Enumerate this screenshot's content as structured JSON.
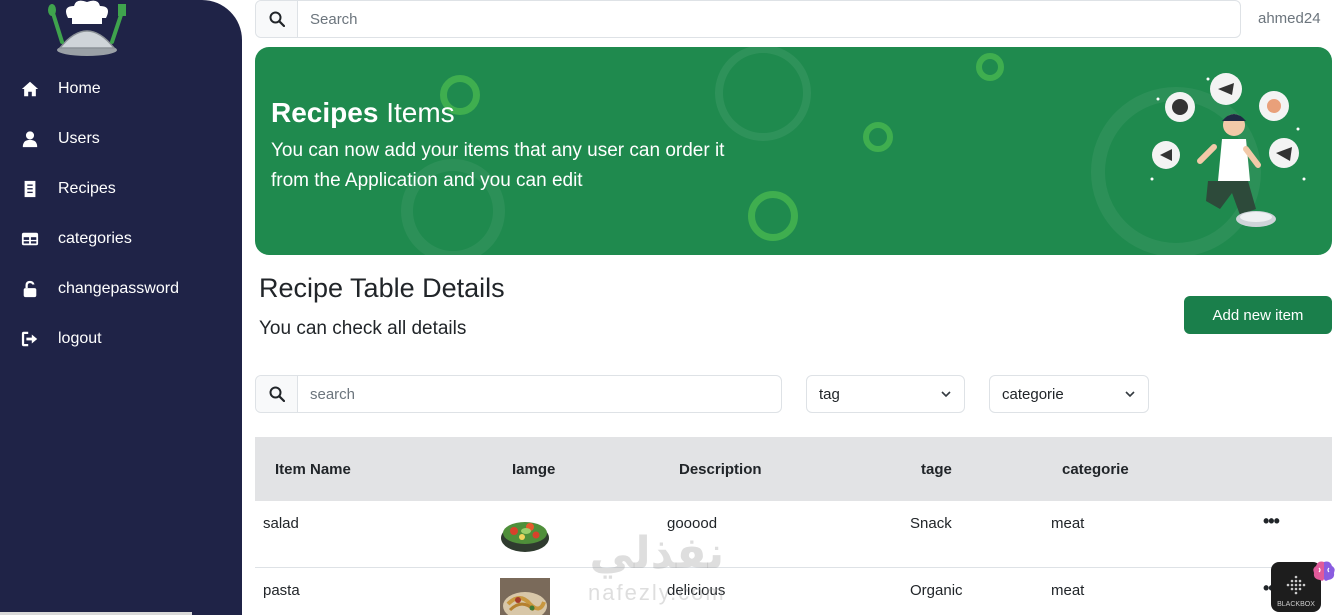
{
  "user": {
    "name": "ahmed24"
  },
  "search": {
    "placeholder": "Search"
  },
  "sidebar": {
    "items": [
      {
        "label": "Home",
        "icon": "home-icon"
      },
      {
        "label": "Users",
        "icon": "user-icon"
      },
      {
        "label": "Recipes",
        "icon": "recipes-icon"
      },
      {
        "label": "categories",
        "icon": "grid-icon"
      },
      {
        "label": "changepassword",
        "icon": "unlock-icon"
      },
      {
        "label": "logout",
        "icon": "logout-icon"
      }
    ]
  },
  "banner": {
    "title_bold": "Recipes",
    "title_rest": "Items",
    "line1": "You can now add your items that any user can order it",
    "line2": "from the Application and you can edit"
  },
  "section": {
    "title": "Recipe Table Details",
    "subtitle": "You can check all details",
    "add_label": "Add new item"
  },
  "filters": {
    "search_placeholder": "search",
    "tag_label": "tag",
    "category_label": "categorie"
  },
  "table": {
    "headers": [
      "Item Name",
      "Iamge",
      "Description",
      "tage",
      "categorie"
    ],
    "rows": [
      {
        "name": "salad",
        "description": "gooood",
        "tag": "Snack",
        "category": "meat"
      },
      {
        "name": "pasta",
        "description": "delicious",
        "tag": "Organic",
        "category": "meat"
      }
    ],
    "more": "•••"
  },
  "watermark": {
    "arabic": "نفذلي",
    "latin": "nafezly.com"
  },
  "blackbox": {
    "label": "BLACKBOX"
  },
  "colors": {
    "sidebar": "#1f2347",
    "banner": "#1f8a4e",
    "button": "#1a7f4b",
    "header_bg": "#e2e3e5"
  }
}
